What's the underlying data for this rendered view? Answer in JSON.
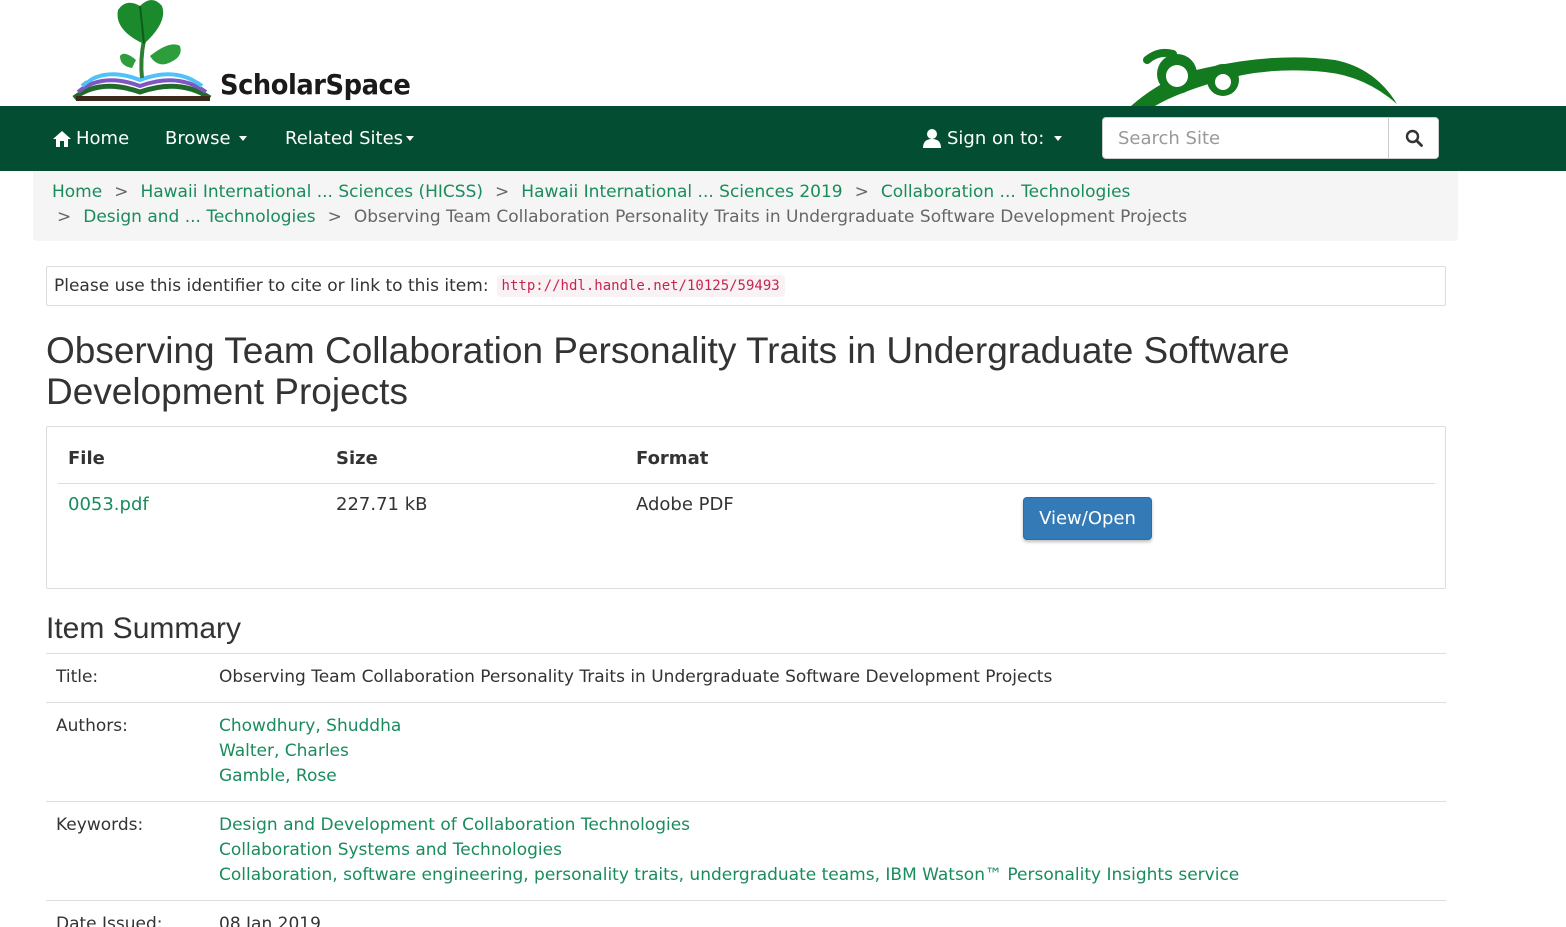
{
  "brand": {
    "name": "ScholarSpace"
  },
  "nav": {
    "home": "Home",
    "browse": "Browse",
    "related_sites": "Related Sites",
    "sign_on": "Sign on to:",
    "search_placeholder": "Search Site"
  },
  "breadcrumb": {
    "items": [
      "Home",
      "Hawaii International ... Sciences (HICSS)",
      "Hawaii International ... Sciences 2019",
      "Collaboration ... Technologies",
      "Design and ... Technologies"
    ],
    "separator": ">",
    "current": "Observing Team Collaboration Personality Traits in Undergraduate Software Development Projects"
  },
  "identifier": {
    "label": "Please use this identifier to cite or link to this item:",
    "url": "http://hdl.handle.net/10125/59493"
  },
  "item": {
    "title": "Observing Team Collaboration Personality Traits in Undergraduate Software Development Projects"
  },
  "files": {
    "headers": {
      "file": "File",
      "size": "Size",
      "format": "Format"
    },
    "rows": [
      {
        "name": "0053.pdf",
        "size": "227.71 kB",
        "format": "Adobe PDF",
        "action": "View/Open"
      }
    ]
  },
  "summary": {
    "heading": "Item Summary",
    "title_label": "Title:",
    "title_value": "Observing Team Collaboration Personality Traits in Undergraduate Software Development Projects",
    "authors_label": "Authors:",
    "authors": [
      "Chowdhury, Shuddha",
      "Walter, Charles",
      "Gamble, Rose"
    ],
    "keywords_label": "Keywords:",
    "keywords": [
      "Design and Development of Collaboration Technologies",
      "Collaboration Systems and Technologies",
      "Collaboration, software engineering, personality traits, undergraduate teams, IBM Watson™ Personality Insights service"
    ],
    "date_label": "Date Issued:",
    "date_value": "08 Jan 2019"
  },
  "colors": {
    "navbar": "#034e32",
    "link": "#1a8c5c",
    "button": "#337ab7",
    "handle_text": "#c7254e"
  },
  "icons": {
    "home": "home-icon",
    "user": "user-icon",
    "search": "search-icon",
    "caret": "caret-down-icon"
  }
}
